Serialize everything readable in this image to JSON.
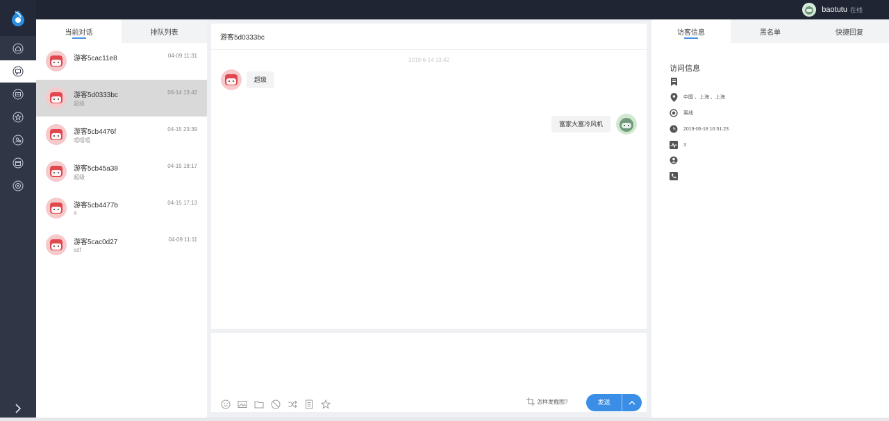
{
  "app": {
    "user": {
      "name": "baotutu",
      "status": "在线"
    }
  },
  "nav": {
    "items": [
      {
        "id": "home",
        "icon": "home-icon"
      },
      {
        "id": "chat",
        "icon": "chat-icon",
        "active": true
      },
      {
        "id": "messages",
        "icon": "message-icon"
      },
      {
        "id": "favorites",
        "icon": "star-icon"
      },
      {
        "id": "users",
        "icon": "user-group-icon"
      },
      {
        "id": "store",
        "icon": "store-icon"
      },
      {
        "id": "settings",
        "icon": "settings-icon"
      }
    ]
  },
  "conversations": {
    "tabs": [
      {
        "label": "当前对话",
        "active": true
      },
      {
        "label": "排队列表",
        "active": false
      }
    ],
    "items": [
      {
        "name": "游客5cac11e8",
        "time": "04-09 11:31",
        "preview": ""
      },
      {
        "name": "游客5d0333bc",
        "time": "06-14 13:42",
        "preview": "超级",
        "selected": true
      },
      {
        "name": "游客5cb4476f",
        "time": "04-15 23:39",
        "preview": "嘻嘻嘻"
      },
      {
        "name": "游客5cb45a38",
        "time": "04-15 18:17",
        "preview": "超级"
      },
      {
        "name": "游客5cb4477b",
        "time": "04-15 17:13",
        "preview": "4"
      },
      {
        "name": "游客5cac0d27",
        "time": "04-09 11:11",
        "preview": "sdf"
      }
    ]
  },
  "chat": {
    "title": "游客5d0333bc",
    "date": "2019-6-14 13:42",
    "messages": [
      {
        "from": "visitor",
        "text": "超级"
      },
      {
        "from": "agent",
        "text": "富家大富冷风机"
      }
    ]
  },
  "composer": {
    "tools": [
      "emoji-icon",
      "image-icon",
      "folder-icon",
      "block-icon",
      "transfer-icon",
      "notes-icon",
      "star-icon"
    ],
    "screenshot_help": "怎样发截图?",
    "send_label": "发送"
  },
  "visitor": {
    "tabs": [
      {
        "label": "访客信息",
        "active": true
      },
      {
        "label": "黑名单",
        "active": false
      },
      {
        "label": "快捷回复",
        "active": false
      }
    ],
    "section_title": "访问信息",
    "rows": [
      {
        "icon": "bookmark-icon",
        "text": ""
      },
      {
        "icon": "location-icon",
        "text": "中国 、上海 、上海"
      },
      {
        "icon": "status-dot-icon",
        "text": "离线"
      },
      {
        "icon": "clock-icon",
        "text": "2019-06-18 16:51:23"
      },
      {
        "icon": "activity-icon",
        "text": "3"
      },
      {
        "icon": "person-icon",
        "text": ""
      },
      {
        "icon": "phone-icon",
        "text": ""
      }
    ]
  },
  "colors": {
    "topbar": "#1f2533",
    "rail": "#2f3646",
    "accent": "#3a8ee6",
    "selected_row": "#d9d9d9"
  }
}
